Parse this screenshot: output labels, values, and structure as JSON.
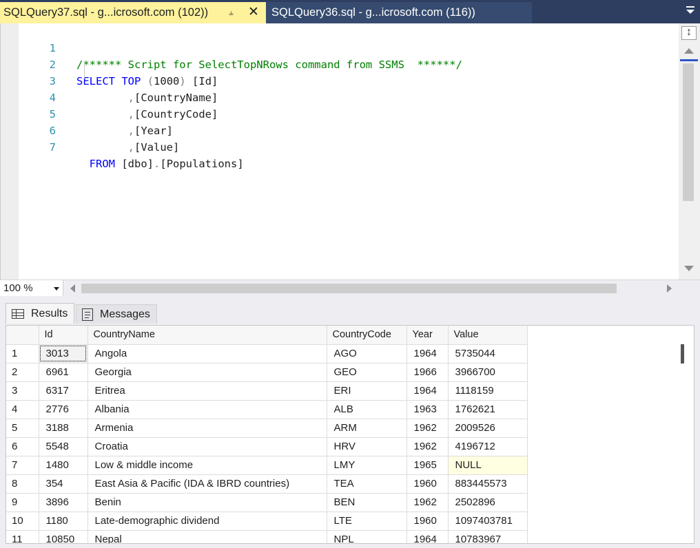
{
  "tabs": [
    {
      "title": "SQLQuery37.sql - g...icrosoft.com (102))",
      "pin_icon": "pin-icon",
      "close_icon": "close-icon",
      "active": true
    },
    {
      "title": "SQLQuery36.sql - g...icrosoft.com (116))",
      "active": false
    }
  ],
  "colors": {
    "active_tab": "#fff29d",
    "tabstrip": "#2d3e60",
    "keyword": "#0000ff",
    "comment": "#008000",
    "line_number": "#2b91af",
    "null_cell": "#ffffe1"
  },
  "editor": {
    "line_numbers": [
      "1",
      "2",
      "3",
      "4",
      "5",
      "6",
      "7"
    ],
    "line1": {
      "comment": "/****** Script for SelectTopNRows command from SSMS  ******/"
    },
    "line2": {
      "kw1": "SELECT",
      "kw2": "TOP",
      "paren_open": "(",
      "number": "1000",
      "paren_close": ")",
      "col": "[Id]"
    },
    "line3": {
      "comma": ",",
      "col": "[CountryName]"
    },
    "line4": {
      "comma": ",",
      "col": "[CountryCode]"
    },
    "line5": {
      "comma": ",",
      "col": "[Year]"
    },
    "line6": {
      "comma": ",",
      "col": "[Value]"
    },
    "line7": {
      "kw": "FROM",
      "schema": "[dbo]",
      "dot": ".",
      "table": "[Populations]"
    }
  },
  "zoom": {
    "value": "100 %"
  },
  "results_tabs": {
    "results": "Results",
    "messages": "Messages"
  },
  "grid": {
    "columns": [
      "",
      "Id",
      "CountryName",
      "CountryCode",
      "Year",
      "Value"
    ],
    "rows": [
      {
        "n": "1",
        "id": "3013",
        "name": "Angola",
        "code": "AGO",
        "year": "1964",
        "value": "5735044"
      },
      {
        "n": "2",
        "id": "6961",
        "name": "Georgia",
        "code": "GEO",
        "year": "1966",
        "value": "3966700"
      },
      {
        "n": "3",
        "id": "6317",
        "name": "Eritrea",
        "code": "ERI",
        "year": "1964",
        "value": "1118159"
      },
      {
        "n": "4",
        "id": "2776",
        "name": "Albania",
        "code": "ALB",
        "year": "1963",
        "value": "1762621"
      },
      {
        "n": "5",
        "id": "3188",
        "name": "Armenia",
        "code": "ARM",
        "year": "1962",
        "value": "2009526"
      },
      {
        "n": "6",
        "id": "5548",
        "name": "Croatia",
        "code": "HRV",
        "year": "1962",
        "value": "4196712"
      },
      {
        "n": "7",
        "id": "1480",
        "name": "Low & middle income",
        "code": "LMY",
        "year": "1965",
        "value": "NULL"
      },
      {
        "n": "8",
        "id": "354",
        "name": "East Asia & Pacific (IDA & IBRD countries)",
        "code": "TEA",
        "year": "1960",
        "value": "883445573"
      },
      {
        "n": "9",
        "id": "3896",
        "name": "Benin",
        "code": "BEN",
        "year": "1962",
        "value": "2502896"
      },
      {
        "n": "10",
        "id": "1180",
        "name": "Late-demographic dividend",
        "code": "LTE",
        "year": "1960",
        "value": "1097403781"
      },
      {
        "n": "11",
        "id": "10850",
        "name": "Nepal",
        "code": "NPL",
        "year": "1964",
        "value": "10783967"
      }
    ]
  }
}
